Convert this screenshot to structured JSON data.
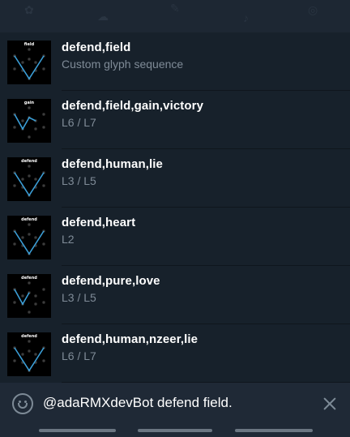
{
  "results": [
    {
      "label": "field",
      "title": "defend,field",
      "subtitle": "Custom glyph sequence"
    },
    {
      "label": "gain",
      "title": "defend,field,gain,victory",
      "subtitle": "L6 / L7"
    },
    {
      "label": "defend",
      "title": "defend,human,lie",
      "subtitle": "L3 / L5"
    },
    {
      "label": "defend",
      "title": "defend,heart",
      "subtitle": "L2"
    },
    {
      "label": "defend",
      "title": "defend,pure,love",
      "subtitle": "L3 / L5"
    },
    {
      "label": "defend",
      "title": "defend,human,nzeer,lie",
      "subtitle": "L6 / L7"
    }
  ],
  "input": {
    "value": "@adaRMXdevBot defend field.",
    "emoji_icon": "smiley-icon",
    "clear_icon": "close-icon"
  },
  "colors": {
    "background": "#17212b",
    "title": "#ffffff",
    "subtitle": "#7f8b97",
    "glyph_line": "#3b9fd8"
  }
}
